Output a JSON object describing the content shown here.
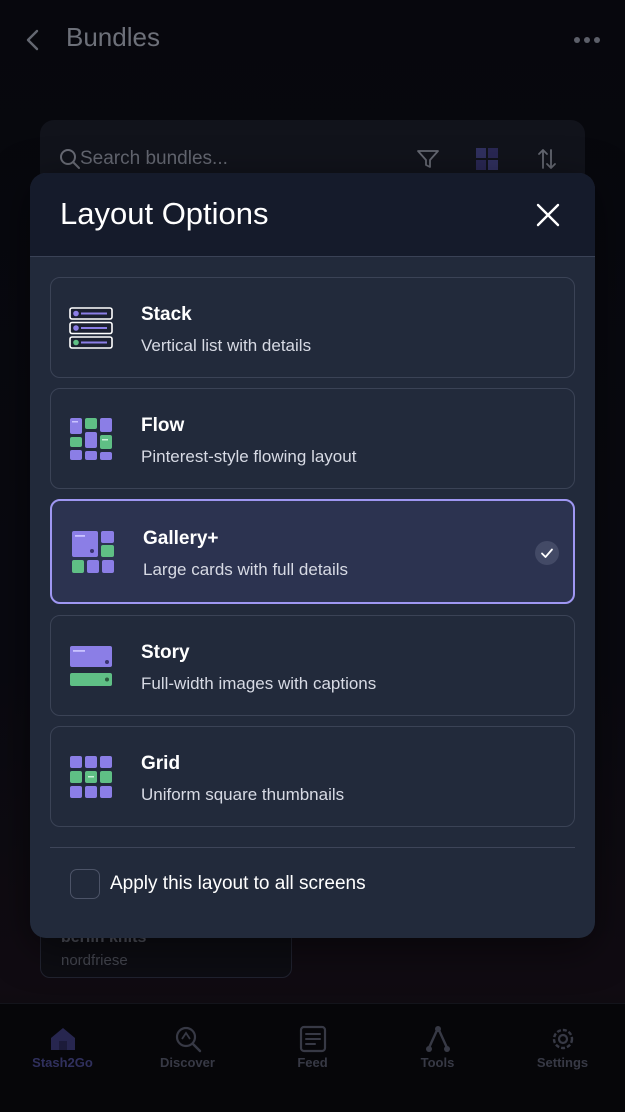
{
  "header": {
    "title": "Bundles"
  },
  "search": {
    "placeholder": "Search bundles..."
  },
  "background_card": {
    "title": "berlin knits",
    "subtitle": "nordfriese"
  },
  "nav": {
    "items": [
      {
        "label": "Stash2Go",
        "icon": "home-icon",
        "active": true
      },
      {
        "label": "Discover",
        "icon": "discover-icon",
        "active": false
      },
      {
        "label": "Feed",
        "icon": "feed-icon",
        "active": false
      },
      {
        "label": "Tools",
        "icon": "tools-icon",
        "active": false
      },
      {
        "label": "Settings",
        "icon": "settings-icon",
        "active": false
      }
    ]
  },
  "modal": {
    "title": "Layout Options",
    "options": [
      {
        "title": "Stack",
        "description": "Vertical list with details",
        "icon": "stack-layout-icon",
        "selected": false
      },
      {
        "title": "Flow",
        "description": "Pinterest-style flowing layout",
        "icon": "flow-layout-icon",
        "selected": false
      },
      {
        "title": "Gallery+",
        "description": "Large cards with full details",
        "icon": "gallery-layout-icon",
        "selected": true
      },
      {
        "title": "Story",
        "description": "Full-width images with captions",
        "icon": "story-layout-icon",
        "selected": false
      },
      {
        "title": "Grid",
        "description": "Uniform square thumbnails",
        "icon": "grid-layout-icon",
        "selected": false
      }
    ],
    "apply_all": {
      "label": "Apply this layout to all screens",
      "checked": false
    }
  },
  "colors": {
    "accent_purple": "#8b7ee6",
    "accent_green": "#5fbf85",
    "selected_border": "#9f97f2",
    "modal_bg": "#222a3b"
  }
}
